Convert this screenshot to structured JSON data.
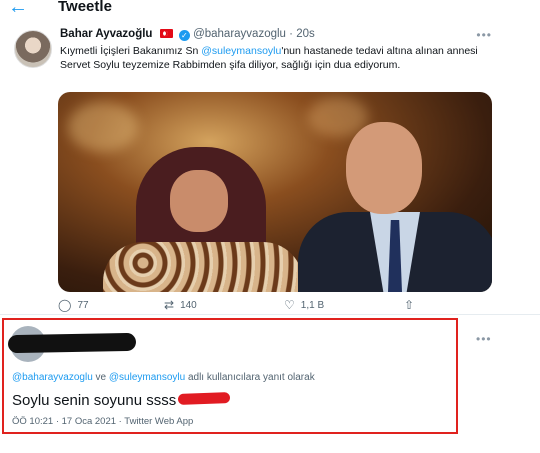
{
  "header": {
    "back_icon": "back-arrow-icon",
    "title": "Tweetle"
  },
  "tweet": {
    "display_name": "Bahar Ayvazoğlu",
    "handle": "@baharayvazoglu",
    "separator": "·",
    "time_ago": "20s",
    "text_before": "Kıymetli İçişleri Bakanımız Sn ",
    "mention": "@suleymansoylu",
    "text_after": "'nun hastanede tedavi altına alınan annesi Servet Soylu teyzemize Rabbimden şifa diliyor, sağlığı için dua ediyorum.",
    "stats": {
      "replies": "77",
      "retweets": "140",
      "likes": "1,1 B"
    }
  },
  "reply": {
    "reply_to_mention1": "@baharayvazoglu",
    "reply_to_and": " ve ",
    "reply_to_mention2": "@suleymansoylu",
    "reply_to_suffix": " adlı kullanıcılara yanıt olarak",
    "text": "Soylu senin soyunu ssss",
    "meta": "ÖÖ 10:21 · 17 Oca 2021 · Twitter Web App"
  },
  "colors": {
    "accent": "#1d9bf0",
    "highlight_border": "#e0221e",
    "redaction_red": "#e11b22"
  }
}
